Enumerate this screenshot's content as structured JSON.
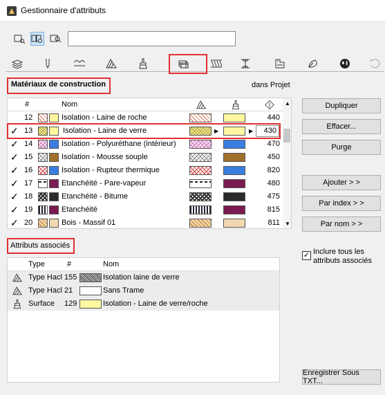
{
  "window": {
    "title": "Gestionnaire d'attributs"
  },
  "toolbar": {
    "icons": [
      "view-single-icon",
      "view-double-icon",
      "view-search-icon"
    ],
    "search_value": ""
  },
  "tabs": [
    {
      "icon": "layers-icon"
    },
    {
      "icon": "pen-icon"
    },
    {
      "icon": "line-type-icon"
    },
    {
      "icon": "hatch-icon"
    },
    {
      "icon": "surface-brush-icon"
    },
    {
      "icon": "building-material-icon",
      "selected": true
    },
    {
      "icon": "composite-icon"
    },
    {
      "icon": "profile-icon"
    },
    {
      "icon": "zone-category-icon"
    },
    {
      "icon": "mep-icon"
    },
    {
      "icon": "globe-icon"
    },
    {
      "icon": "renovation-icon"
    }
  ],
  "materials": {
    "section_label": "Matériaux de construction",
    "scope_label": "dans Projet",
    "columns": {
      "num": "#",
      "name": "Nom"
    },
    "rows": [
      {
        "checked": false,
        "num": "12",
        "name": "Isolation - Laine de roche",
        "fill": "pat-diag",
        "surface": "#fff8a0",
        "priority": "440"
      },
      {
        "checked": true,
        "num": "13",
        "name": "Isolation - Laine de verre",
        "fill": "pat-cross-y",
        "surface": "#fff8a0",
        "priority": "430",
        "selected": true
      },
      {
        "checked": true,
        "num": "14",
        "name": "Isolation - Polyuréthane (intérieur)",
        "fill": "pat-pink",
        "surface": "#3a7ee0",
        "priority": "470"
      },
      {
        "checked": true,
        "num": "15",
        "name": "Isolation - Mousse souple",
        "fill": "pat-cross",
        "surface": "#a0702a",
        "priority": "450"
      },
      {
        "checked": true,
        "num": "16",
        "name": "Isolation - Rupteur thermique",
        "fill": "pat-red",
        "surface": "#3a7ee0",
        "priority": "820"
      },
      {
        "checked": true,
        "num": "17",
        "name": "Etanchéité - Pare-vapeur",
        "fill": "pat-dash",
        "surface": "#7a1a50",
        "priority": "480"
      },
      {
        "checked": true,
        "num": "18",
        "name": "Etanchéité - Bitume",
        "fill": "pat-check",
        "surface": "#2a2a2a",
        "priority": "475"
      },
      {
        "checked": true,
        "num": "19",
        "name": "Etanchéité",
        "fill": "pat-vbar",
        "surface": "#7a1a50",
        "priority": "815"
      },
      {
        "checked": true,
        "num": "20",
        "name": "Bois - Massif 01",
        "fill": "pat-wood",
        "surface": "#f0d8b0",
        "priority": "811"
      }
    ]
  },
  "buttons": {
    "duplicate": "Dupliquer",
    "delete": "Effacer...",
    "purge": "Purge",
    "append": "Ajouter > >",
    "by_index": "Par index > >",
    "by_name": "Par nom > >",
    "save_as": "Enregistrer Sous TXT..."
  },
  "include_all": {
    "checked": true,
    "line1": "Inclure tous les",
    "line2": "attributs associés"
  },
  "associated": {
    "section_label": "Attributs associés",
    "columns": {
      "type": "Type",
      "num": "#",
      "name": "Nom"
    },
    "rows": [
      {
        "icon": "hatch-icon",
        "type": "Type Hacl",
        "num": "155",
        "fill": "pat-dense",
        "name": "Isolation laine de verre"
      },
      {
        "icon": "hatch-icon",
        "type": "Type Hacl",
        "num": "21",
        "fill": "",
        "name": "Sans Trame"
      },
      {
        "icon": "surface-brush-icon",
        "type": "Surface",
        "num": "129",
        "fill": "surface-yellow",
        "name": "Isolation - Laine de verre/roche"
      }
    ]
  },
  "colors": {
    "highlight": "#e03030",
    "selection_fill": "#cde3f7"
  }
}
